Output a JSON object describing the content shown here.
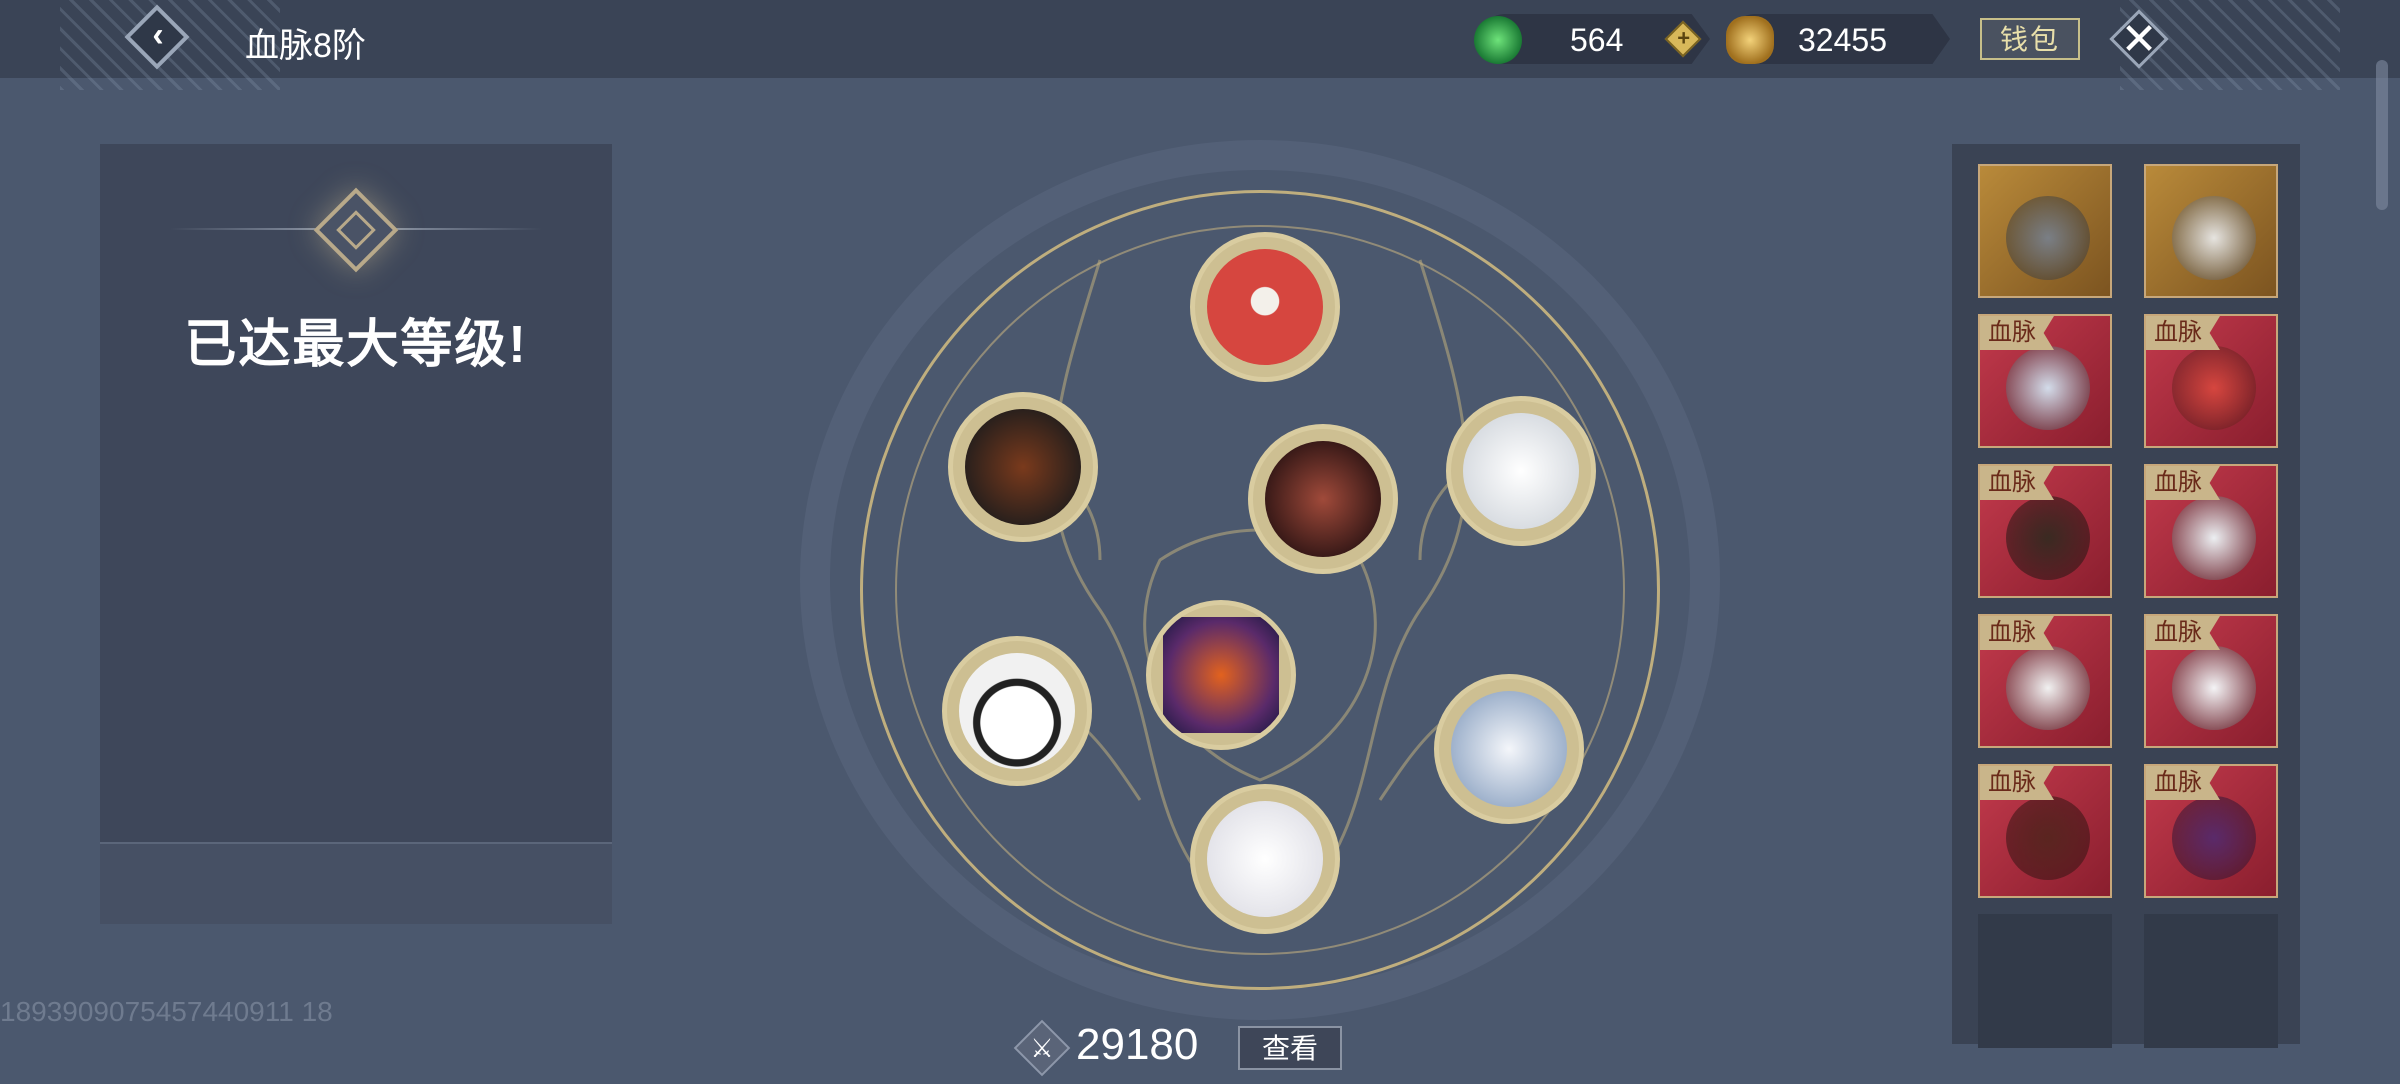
{
  "header": {
    "title": "血脉8阶",
    "jade": {
      "value": "564",
      "icon": "jade-coin-icon"
    },
    "gold": {
      "value": "32455",
      "icon": "gold-ingot-icon"
    },
    "wallet_label": "钱包"
  },
  "left_panel": {
    "status_text": "已达最大等级!"
  },
  "uid": "1893909075457440911 18",
  "power": {
    "value": "29180",
    "view_label": "查看"
  },
  "slots": [
    {
      "name": "red-panda",
      "color": "#d6463f"
    },
    {
      "name": "fire-dragon",
      "color": "#3a2a22"
    },
    {
      "name": "white-wolf",
      "color": "#eceff2"
    },
    {
      "name": "demon-beast",
      "color": "#5a2520"
    },
    {
      "name": "panda",
      "color": "#f1f1f1"
    },
    {
      "name": "magma-beast",
      "color": "#5a2a6a"
    },
    {
      "name": "ice-wolf",
      "color": "#c9d6e8"
    },
    {
      "name": "white-rabbit",
      "color": "#f4f4f6"
    }
  ],
  "inventory": {
    "tag_label": "血脉",
    "items": [
      {
        "name": "gray-wolf",
        "bg": "gold",
        "tag": false,
        "color": "#7a7f86"
      },
      {
        "name": "white-monkey",
        "bg": "gold",
        "tag": false,
        "color": "#e6e4e0"
      },
      {
        "name": "ice-wolf",
        "bg": "red",
        "tag": true,
        "color": "#d3dcea"
      },
      {
        "name": "red-panda",
        "bg": "red",
        "tag": true,
        "color": "#d6463f"
      },
      {
        "name": "fire-dragon",
        "bg": "red",
        "tag": true,
        "color": "#3a2a22"
      },
      {
        "name": "white-wolf",
        "bg": "red",
        "tag": true,
        "color": "#eceff2"
      },
      {
        "name": "panda",
        "bg": "red",
        "tag": true,
        "color": "#f1f1f1"
      },
      {
        "name": "white-rabbit",
        "bg": "red",
        "tag": true,
        "color": "#f4f4f6"
      },
      {
        "name": "demon-beast",
        "bg": "red",
        "tag": true,
        "color": "#5a2520"
      },
      {
        "name": "magma-beast",
        "bg": "red",
        "tag": true,
        "color": "#5a2a6a"
      },
      {
        "name": "empty",
        "bg": "empty",
        "tag": false,
        "color": ""
      },
      {
        "name": "empty",
        "bg": "empty",
        "tag": false,
        "color": ""
      }
    ]
  }
}
